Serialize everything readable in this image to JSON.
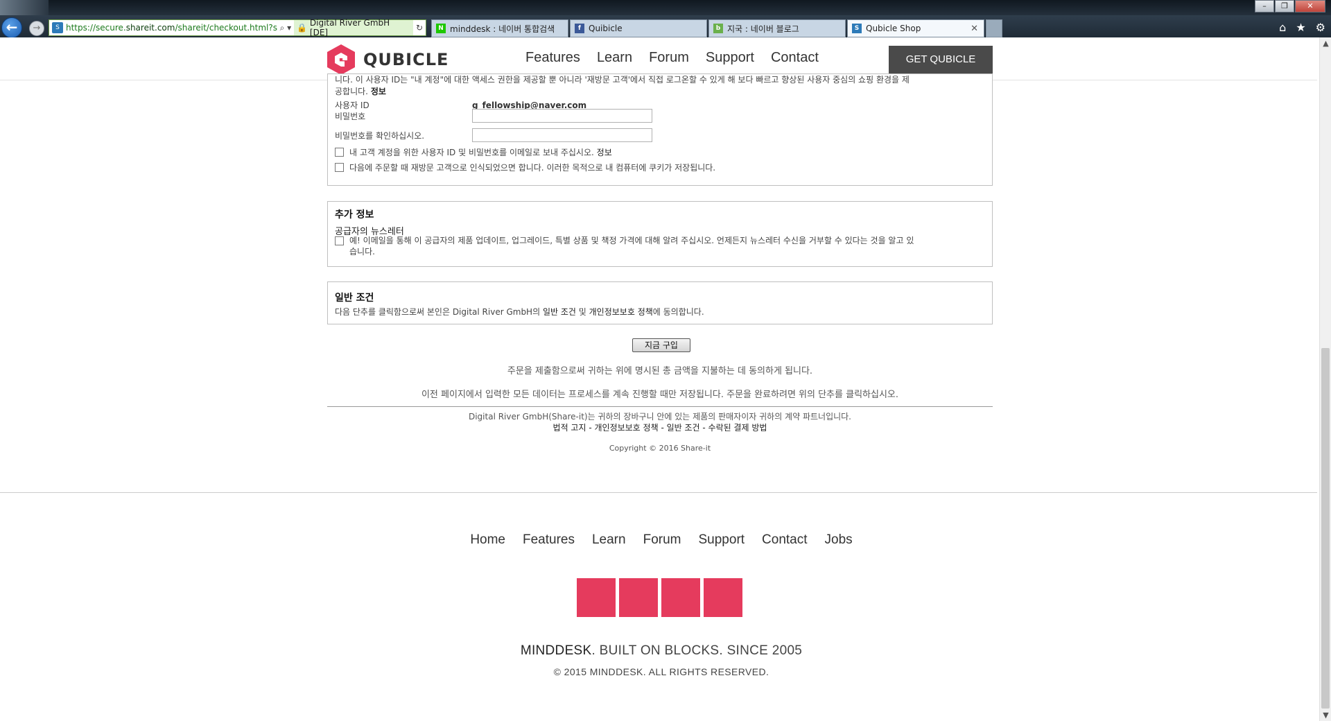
{
  "browser": {
    "url_prefix": "https://secure.",
    "url_domain": "shareit.com",
    "url_path": "/shareit/checkout.html?session",
    "cert_label": "Digital River GmbH [DE]",
    "tabs": [
      {
        "label": "minddesk : 네이버 통합검색",
        "icon_color": "#1ec800",
        "icon_text": "N"
      },
      {
        "label": "Quibicle",
        "icon_color": "#3b5998",
        "icon_text": "f"
      },
      {
        "label": "지국 : 네이버 블로그",
        "icon_color": "#6ab04c",
        "icon_text": "b"
      },
      {
        "label": "Qubicle Shop",
        "icon_color": "#2d7ab8",
        "icon_text": "S"
      }
    ],
    "blurred_title": "(blurred window title)"
  },
  "header": {
    "logo_text": "QUBICLE",
    "nav": [
      "Features",
      "Learn",
      "Forum",
      "Support",
      "Contact"
    ],
    "cta": "GET QUBICLE"
  },
  "account": {
    "intro_line1": "니다. 이 사용자 ID는 \"내 계정\"에 대한 액세스 권한을 제공할 뿐 아니라 '재방문 고객'에서 직접 로그온할 수 있게 해 보다 빠르고 향상된 사용자 중심의 쇼핑 환경을 제",
    "intro_line2": "공합니다.",
    "intro_link": "정보",
    "user_id_label": "사용자 ID",
    "user_id_value": "g_fellowship@naver.com",
    "password_label": "비밀번호",
    "password_confirm_label": "비밀번호를 확인하십시오.",
    "email_checkbox": "내 고객 계정을 위한 사용자 ID 및 비밀번호를 이메일로 보내 주십시오.",
    "email_checkbox_link": "정보",
    "cookie_checkbox": "다음에 주문할 때 재방문 고객으로 인식되었으면 합니다. 이러한 목적으로 내 컴퓨터에 쿠키가 저장됩니다."
  },
  "extra": {
    "title": "추가 정보",
    "newsletter_title": "공급자의 뉴스레터",
    "newsletter_text_1": "예! 이메일을 통해 이 공급자의 제품 업데이트, 업그레이드, 특별 상품 및 책정 가격에 대해 알려 주십시오. 언제든지 뉴스레터 수신을 거부할 수 있다는 것을 알고 있",
    "newsletter_text_2": "습니다."
  },
  "terms": {
    "title": "일반 조건",
    "text_pre": "다음 단추를 클릭함으로써 본인은 Digital River GmbH의",
    "link_terms": "일반 조건",
    "text_and": "및",
    "link_privacy": "개인정보보호 정책",
    "text_post": "에 동의합니다."
  },
  "checkout": {
    "buy_button": "지금 구입",
    "notice1": "주문을 제출함으로써 귀하는 위에 명시된 총 금액을 지불하는 데 동의하게 됩니다.",
    "notice2": "이전 페이지에서 입력한 모든 데이터는 프로세스를 계속 진행할 때만 저장됩니다. 주문을 완료하려면 위의 단추를 클릭하십시오.",
    "partner_text": "Digital River GmbH(Share-it)는 귀하의 장바구니 안에 있는 제품의 판매자이자 귀하의 계약 파트너입니다.",
    "legal_links": [
      "법적 고지",
      "개인정보보호 정책",
      "일반 조건",
      "수락된 결제 방법"
    ],
    "legal_sep": " - ",
    "copyright": "Copyright © 2016 Share-it"
  },
  "footer": {
    "nav": [
      "Home",
      "Features",
      "Learn",
      "Forum",
      "Support",
      "Contact",
      "Jobs"
    ],
    "brand": "MINDDESK",
    "tagline_rest": ". BUILT ON BLOCKS. SINCE 2005",
    "copyright": "© 2015 MINDDESK. ALL RIGHTS RESERVED.",
    "block_color": "#e53b5d"
  },
  "colors": {
    "accent": "#e53b5d",
    "cta_bg": "#4a4a4a"
  }
}
